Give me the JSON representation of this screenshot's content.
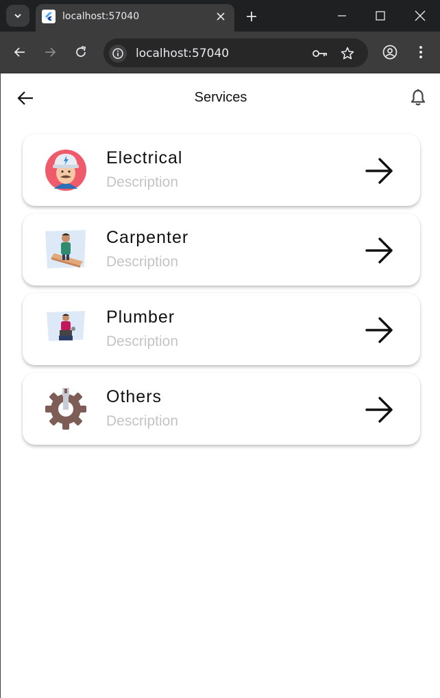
{
  "browser": {
    "tab_title": "localhost:57040",
    "url": "localhost:57040"
  },
  "appbar": {
    "title": "Services"
  },
  "services": [
    {
      "title": "Electrical",
      "description": "Description",
      "icon": "electrician-avatar-icon"
    },
    {
      "title": "Carpenter",
      "description": "Description",
      "icon": "carpenter-illustration-icon"
    },
    {
      "title": "Plumber",
      "description": "Description",
      "icon": "plumber-illustration-icon"
    },
    {
      "title": "Others",
      "description": "Description",
      "icon": "gear-wrench-icon"
    }
  ],
  "colors": {
    "chrome_dark": "#1f2021",
    "chrome_toolbar": "#3c3c3c",
    "description_grey": "#c4c4c4",
    "arrow": "#111111"
  }
}
